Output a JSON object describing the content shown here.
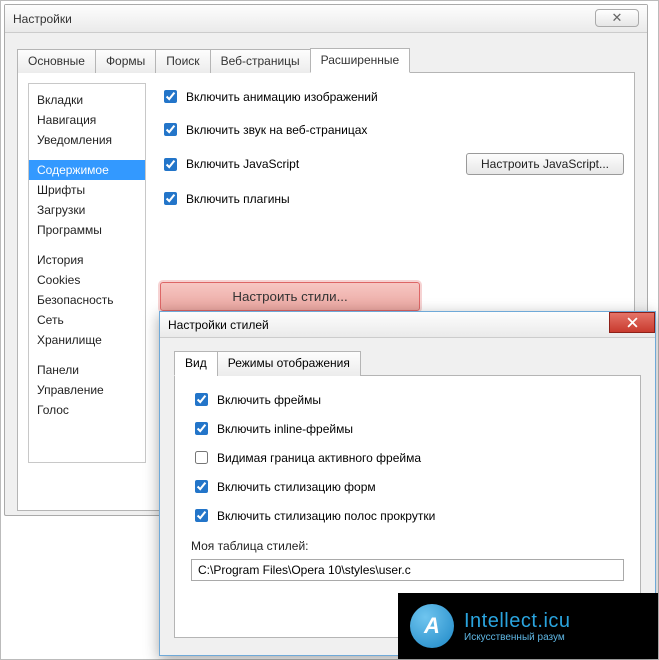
{
  "mainWindow": {
    "title": "Настройки",
    "tabs": [
      "Основные",
      "Формы",
      "Поиск",
      "Веб-страницы",
      "Расширенные"
    ],
    "activeTab": 4,
    "sidebar": {
      "groups": [
        [
          "Вкладки",
          "Навигация",
          "Уведомления"
        ],
        [
          "Содержимое",
          "Шрифты",
          "Загрузки",
          "Программы"
        ],
        [
          "История",
          "Cookies",
          "Безопасность",
          "Сеть",
          "Хранилище"
        ],
        [
          "Панели",
          "Управление",
          "Голос"
        ]
      ],
      "selected": "Содержимое"
    },
    "content": {
      "enableImageAnimation": "Включить анимацию изображений",
      "enableSoundWeb": "Включить звук на веб-страницах",
      "enableJS": "Включить JavaScript",
      "configureJSBtn": "Настроить JavaScript...",
      "enablePlugins": "Включить плагины",
      "configureStylesBtn": "Настроить стили..."
    }
  },
  "childWindow": {
    "title": "Настройки стилей",
    "tabs": [
      "Вид",
      "Режимы отображения"
    ],
    "activeTab": 0,
    "checks": {
      "enableFrames": "Включить фреймы",
      "enableInlineFrames": "Включить inline-фреймы",
      "visibleActiveFrameBorder": "Видимая граница активного фрейма",
      "enableFormStyling": "Включить стилизацию форм",
      "enableScrollbarStyling": "Включить стилизацию полос прокрутки"
    },
    "styleSheetLabel": "Моя таблица стилей:",
    "styleSheetPath": "C:\\Program Files\\Opera 10\\styles\\user.c"
  },
  "watermark": {
    "badge": "A",
    "line1": "Intellect.icu",
    "line2": "Искусственный разум"
  }
}
